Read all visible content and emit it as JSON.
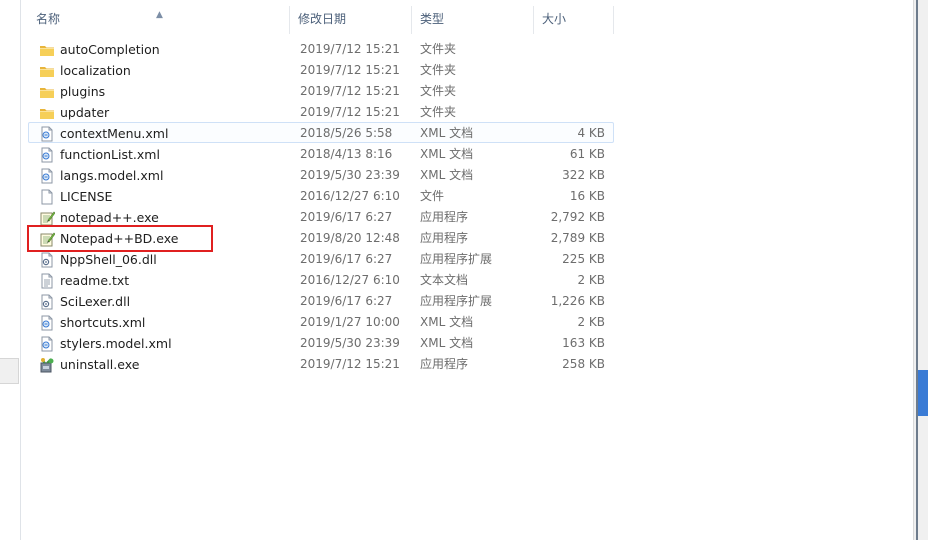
{
  "columns": {
    "name": "名称",
    "date": "修改日期",
    "type": "类型",
    "size": "大小"
  },
  "files": [
    {
      "name": "autoCompletion",
      "date": "2019/7/12 15:21",
      "type": "文件夹",
      "size": "",
      "icon": "folder-icon"
    },
    {
      "name": "localization",
      "date": "2019/7/12 15:21",
      "type": "文件夹",
      "size": "",
      "icon": "folder-icon"
    },
    {
      "name": "plugins",
      "date": "2019/7/12 15:21",
      "type": "文件夹",
      "size": "",
      "icon": "folder-icon"
    },
    {
      "name": "updater",
      "date": "2019/7/12 15:21",
      "type": "文件夹",
      "size": "",
      "icon": "folder-icon"
    },
    {
      "name": "contextMenu.xml",
      "date": "2018/5/26 5:58",
      "type": "XML 文档",
      "size": "4 KB",
      "icon": "xml-file-icon"
    },
    {
      "name": "functionList.xml",
      "date": "2018/4/13 8:16",
      "type": "XML 文档",
      "size": "61 KB",
      "icon": "xml-file-icon"
    },
    {
      "name": "langs.model.xml",
      "date": "2019/5/30 23:39",
      "type": "XML 文档",
      "size": "322 KB",
      "icon": "xml-file-icon"
    },
    {
      "name": "LICENSE",
      "date": "2016/12/27 6:10",
      "type": "文件",
      "size": "16 KB",
      "icon": "blank-file-icon"
    },
    {
      "name": "notepad++.exe",
      "date": "2019/6/17 6:27",
      "type": "应用程序",
      "size": "2,792 KB",
      "icon": "notepad-exe-icon"
    },
    {
      "name": "Notepad++BD.exe",
      "date": "2019/8/20 12:48",
      "type": "应用程序",
      "size": "2,789 KB",
      "icon": "notepad-exe-icon"
    },
    {
      "name": "NppShell_06.dll",
      "date": "2019/6/17 6:27",
      "type": "应用程序扩展",
      "size": "225 KB",
      "icon": "dll-file-icon"
    },
    {
      "name": "readme.txt",
      "date": "2016/12/27 6:10",
      "type": "文本文档",
      "size": "2 KB",
      "icon": "text-file-icon"
    },
    {
      "name": "SciLexer.dll",
      "date": "2019/6/17 6:27",
      "type": "应用程序扩展",
      "size": "1,226 KB",
      "icon": "dll-file-icon"
    },
    {
      "name": "shortcuts.xml",
      "date": "2019/1/27 10:00",
      "type": "XML 文档",
      "size": "2 KB",
      "icon": "xml-file-icon"
    },
    {
      "name": "stylers.model.xml",
      "date": "2019/5/30 23:39",
      "type": "XML 文档",
      "size": "163 KB",
      "icon": "xml-file-icon"
    },
    {
      "name": "uninstall.exe",
      "date": "2019/7/12 15:21",
      "type": "应用程序",
      "size": "258 KB",
      "icon": "uninstall-exe-icon"
    }
  ],
  "colors": {
    "highlight": "#e02020",
    "hover_border": "#cfe1f7",
    "header_text": "#4c607a",
    "scroll_accent": "#3a7bd5"
  }
}
